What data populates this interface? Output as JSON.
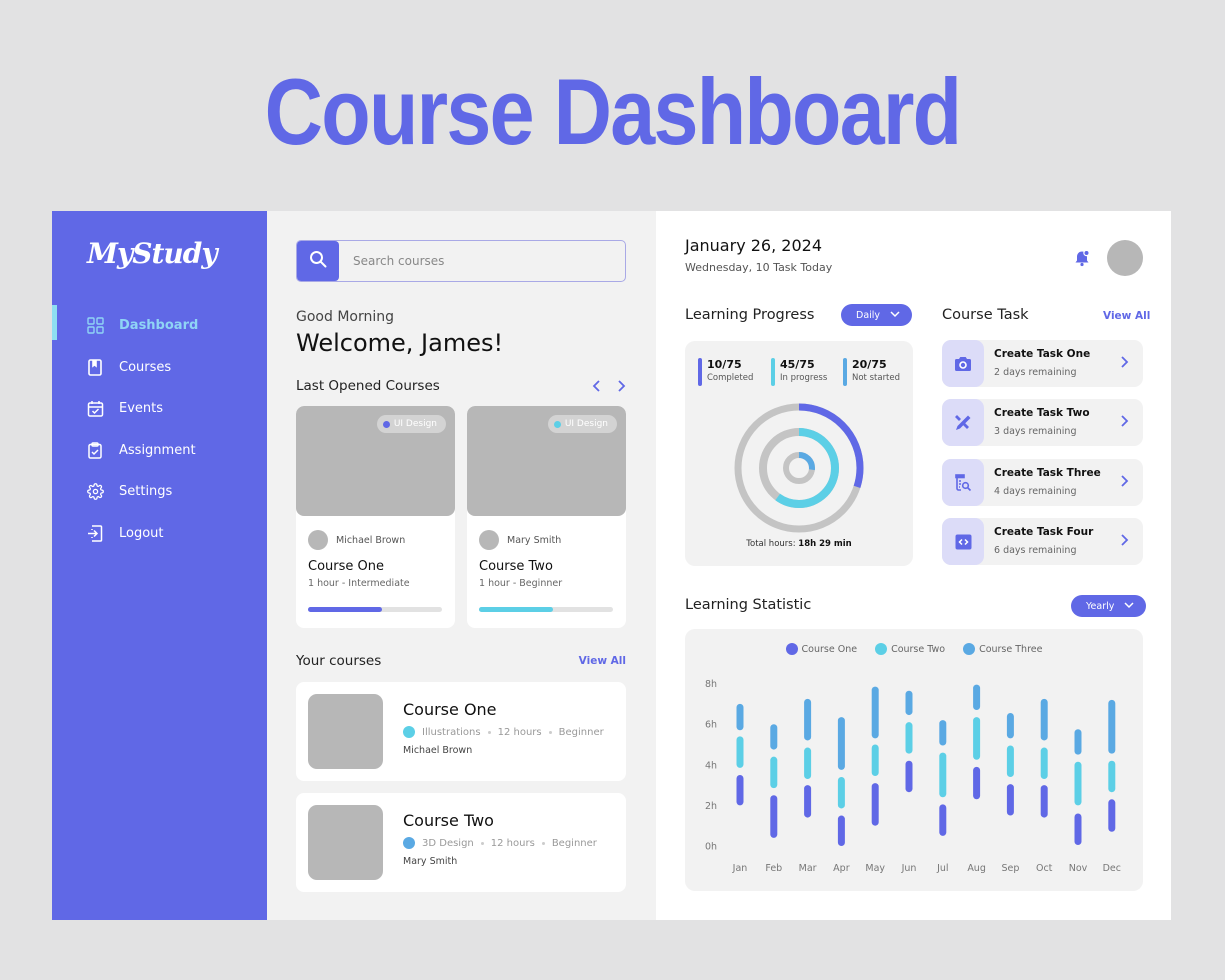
{
  "hero": {
    "title": "Course Dashboard"
  },
  "colors": {
    "primary": "#6068e6",
    "cyan": "#5ccfe6",
    "blue": "#5aa9e3",
    "gray": "#b7b7b7",
    "active_nav": "#8fd4f5"
  },
  "sidebar": {
    "logo": "MyStudy",
    "items": [
      {
        "label": "Dashboard",
        "icon": "grid-icon",
        "active": true
      },
      {
        "label": "Courses",
        "icon": "book-icon",
        "active": false
      },
      {
        "label": "Events",
        "icon": "calendar-check-icon",
        "active": false
      },
      {
        "label": "Assignment",
        "icon": "clipboard-check-icon",
        "active": false
      },
      {
        "label": "Settings",
        "icon": "gear-icon",
        "active": false
      },
      {
        "label": "Logout",
        "icon": "logout-icon",
        "active": false
      }
    ]
  },
  "search": {
    "placeholder": "Search courses",
    "value": ""
  },
  "greeting": {
    "line1": "Good Morning",
    "line2": "Welcome, James!"
  },
  "last_opened": {
    "title": "Last Opened Courses",
    "courses": [
      {
        "tag": "UI Design",
        "tag_color": "#6068e6",
        "author": "Michael Brown",
        "title": "Course One",
        "subtitle": "1 hour - Intermediate",
        "progress": 0.55,
        "bar_color": "#6068e6"
      },
      {
        "tag": "UI Design",
        "tag_color": "#5ccfe6",
        "author": "Mary Smith",
        "title": "Course Two",
        "subtitle": "1 hour - Beginner",
        "progress": 0.55,
        "bar_color": "#5ccfe6"
      }
    ]
  },
  "your_courses": {
    "title": "Your courses",
    "view_all": "View All",
    "courses": [
      {
        "title": "Course One",
        "category": "Illustrations",
        "category_color": "#5ccfe6",
        "duration": "12 hours",
        "level": "Beginner",
        "author": "Michael Brown"
      },
      {
        "title": "Course Two",
        "category": "3D Design",
        "category_color": "#5aa9e3",
        "duration": "12 hours",
        "level": "Beginner",
        "author": "Mary Smith"
      }
    ]
  },
  "header": {
    "date": "January 26, 2024",
    "subtitle": "Wednesday, 10 Task Today"
  },
  "learning_progress": {
    "title": "Learning Progress",
    "filter": "Daily",
    "stats": [
      {
        "value": "10/75",
        "label": "Completed",
        "color": "#6068e6",
        "fraction": 0.3
      },
      {
        "value": "45/75",
        "label": "In progress",
        "color": "#5ccfe6",
        "fraction": 0.6
      },
      {
        "value": "20/75",
        "label": "Not started",
        "color": "#5aa9e3",
        "fraction": 0.27
      }
    ],
    "total_label": "Total hours:",
    "total_value": "18h 29 min"
  },
  "course_task": {
    "title": "Course Task",
    "view_all": "View All",
    "tasks": [
      {
        "title": "Create Task One",
        "remaining": "2 days remaining",
        "icon": "camera-icon"
      },
      {
        "title": "Create Task Two",
        "remaining": "3 days remaining",
        "icon": "design-tools-icon"
      },
      {
        "title": "Create Task Three",
        "remaining": "4 days remaining",
        "icon": "flask-search-icon"
      },
      {
        "title": "Create Task Four",
        "remaining": "6 days remaining",
        "icon": "code-icon"
      }
    ]
  },
  "learning_statistic": {
    "title": "Learning Statistic",
    "filter": "Yearly"
  },
  "chart_data": {
    "type": "bar",
    "title": "Learning Statistic",
    "subtype": "floating-range-bars",
    "xlabel": "",
    "ylabel": "",
    "categories": [
      "Jan",
      "Feb",
      "Mar",
      "Apr",
      "May",
      "Jun",
      "Jul",
      "Aug",
      "Sep",
      "Oct",
      "Nov",
      "Dec"
    ],
    "y_ticks": [
      "0h",
      "2h",
      "4h",
      "6h",
      "8h"
    ],
    "ylim": [
      0,
      8
    ],
    "legend_position": "top-center",
    "grid": false,
    "series": [
      {
        "name": "Course One",
        "color": "#6068e6",
        "ranges": [
          [
            2.0,
            3.5
          ],
          [
            0.4,
            2.5
          ],
          [
            1.4,
            3.0
          ],
          [
            0,
            1.5
          ],
          [
            1.0,
            3.1
          ],
          [
            2.65,
            4.2
          ],
          [
            0.5,
            2.05
          ],
          [
            2.3,
            3.9
          ],
          [
            1.5,
            3.05
          ],
          [
            1.4,
            3.0
          ],
          [
            0.05,
            1.6
          ],
          [
            0.7,
            2.3
          ]
        ]
      },
      {
        "name": "Course Two",
        "color": "#5ccfe6",
        "ranges": [
          [
            3.85,
            5.4
          ],
          [
            2.85,
            4.4
          ],
          [
            3.3,
            4.85
          ],
          [
            1.85,
            3.4
          ],
          [
            3.45,
            5.0
          ],
          [
            4.55,
            6.1
          ],
          [
            2.4,
            4.6
          ],
          [
            4.25,
            6.35
          ],
          [
            3.4,
            4.95
          ],
          [
            3.3,
            4.85
          ],
          [
            2.0,
            4.15
          ],
          [
            2.65,
            4.2
          ]
        ]
      },
      {
        "name": "Course Three",
        "color": "#5aa9e3",
        "ranges": [
          [
            5.7,
            7.0
          ],
          [
            4.75,
            6.0
          ],
          [
            5.2,
            7.25
          ],
          [
            3.75,
            6.35
          ],
          [
            5.3,
            7.85
          ],
          [
            6.45,
            7.65
          ],
          [
            4.95,
            6.2
          ],
          [
            6.7,
            7.95
          ],
          [
            5.3,
            6.55
          ],
          [
            5.2,
            7.25
          ],
          [
            4.5,
            5.75
          ],
          [
            4.55,
            7.2
          ]
        ]
      }
    ]
  }
}
